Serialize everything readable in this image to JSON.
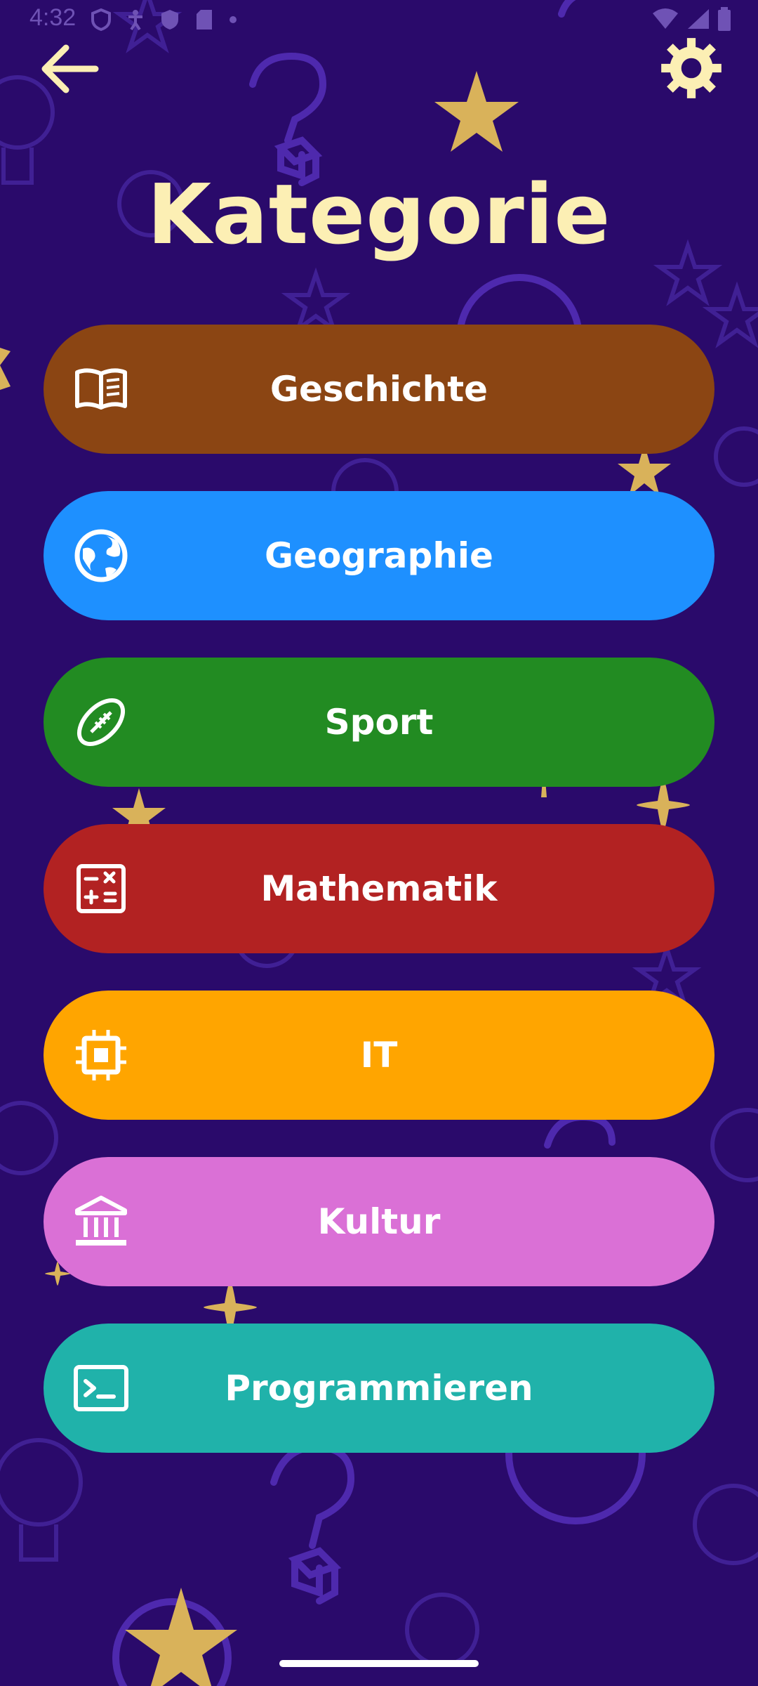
{
  "status_bar": {
    "time": "4:32"
  },
  "header": {
    "back_icon": "arrow-left-icon",
    "settings_icon": "gear-icon",
    "title": "Kategorie"
  },
  "categories": [
    {
      "label": "Geschichte",
      "icon": "book-icon",
      "color": "#8b4513"
    },
    {
      "label": "Geographie",
      "icon": "globe-icon",
      "color": "#1e90ff"
    },
    {
      "label": "Sport",
      "icon": "football-icon",
      "color": "#228b22"
    },
    {
      "label": "Mathematik",
      "icon": "calculator-icon",
      "color": "#b22222"
    },
    {
      "label": "IT",
      "icon": "chip-icon",
      "color": "#ffa500"
    },
    {
      "label": "Kultur",
      "icon": "museum-icon",
      "color": "#da70d6"
    },
    {
      "label": "Programmieren",
      "icon": "terminal-icon",
      "color": "#20b2aa"
    }
  ],
  "colors": {
    "background": "#2a0a6b",
    "accent": "#fcefb4",
    "decoration_purple": "#6a3fd0",
    "decoration_gold": "#d9b25a"
  }
}
